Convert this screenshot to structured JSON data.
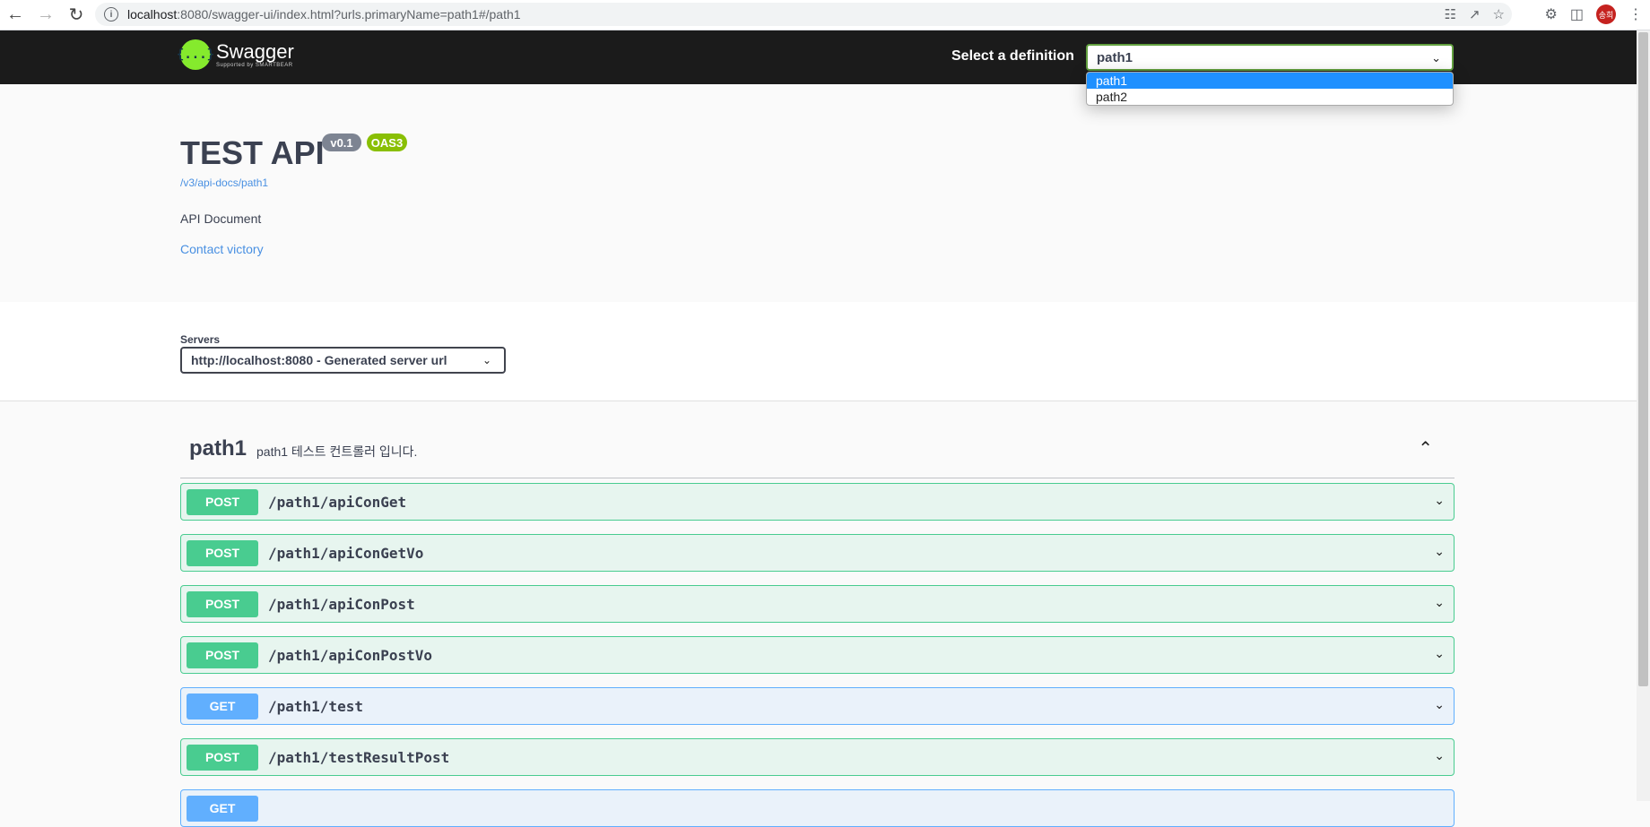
{
  "browser": {
    "url_host": "localhost",
    "url_rest": ":8080/swagger-ui/index.html?urls.primaryName=path1#/path1",
    "avatar_text": "송희"
  },
  "topbar": {
    "logo_symbol": "{...}",
    "logo_title": "Swagger",
    "logo_sub": "Supported by SMARTBEAR",
    "definition_label": "Select a definition",
    "definition_value": "path1",
    "definition_options": [
      "path1",
      "path2"
    ]
  },
  "info": {
    "title": "TEST API",
    "version": "v0.1",
    "oas": "OAS3",
    "spec_url": "/v3/api-docs/path1",
    "description": "API Document",
    "contact": "Contact victory"
  },
  "servers": {
    "label": "Servers",
    "selected": "http://localhost:8080 - Generated server url"
  },
  "tag": {
    "name": "path1",
    "description": "path1 테스트 컨트롤러 입니다."
  },
  "operations": [
    {
      "method": "POST",
      "path": "/path1/apiConGet"
    },
    {
      "method": "POST",
      "path": "/path1/apiConGetVo"
    },
    {
      "method": "POST",
      "path": "/path1/apiConPost"
    },
    {
      "method": "POST",
      "path": "/path1/apiConPostVo"
    },
    {
      "method": "GET",
      "path": "/path1/test"
    },
    {
      "method": "POST",
      "path": "/path1/testResultPost"
    },
    {
      "method": "GET",
      "path": ""
    }
  ],
  "colors": {
    "post": "#49cc90",
    "get": "#61affe",
    "topbar": "#1b1b1b",
    "logo": "#85ea2d",
    "link": "#4990e2"
  }
}
